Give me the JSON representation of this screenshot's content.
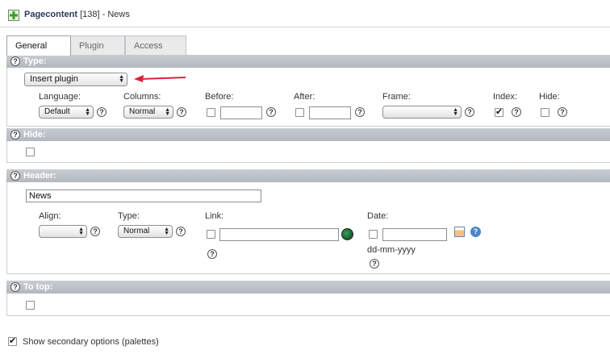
{
  "header": {
    "icon": "page-content-icon",
    "title": "Pagecontent",
    "id_text": "[138]",
    "suffix": " - News"
  },
  "tabs": [
    {
      "label": "General",
      "active": true
    },
    {
      "label": "Plugin",
      "active": false
    },
    {
      "label": "Access",
      "active": false
    }
  ],
  "type_section": {
    "title": "Type:",
    "type_select": "Insert plugin",
    "language_label": "Language:",
    "language_value": "Default",
    "columns_label": "Columns:",
    "columns_value": "Normal",
    "before_label": "Before:",
    "after_label": "After:",
    "frame_label": "Frame:",
    "frame_value": "",
    "index_label": "Index:",
    "hide_label": "Hide:"
  },
  "hide_section": {
    "title": "Hide:"
  },
  "header_section": {
    "title": "Header:",
    "header_value": "News",
    "align_label": "Align:",
    "align_value": "",
    "type_label": "Type:",
    "type_value": "Normal",
    "link_label": "Link:",
    "link_value": "",
    "date_label": "Date:",
    "date_value": "",
    "date_format": "dd-mm-yyyy"
  },
  "totop_section": {
    "title": "To top:"
  },
  "footer": {
    "secondary_options_label": "Show secondary options (palettes)"
  },
  "colors": {
    "arrow": "#e0203a",
    "section_header": "#b3b8bf"
  }
}
